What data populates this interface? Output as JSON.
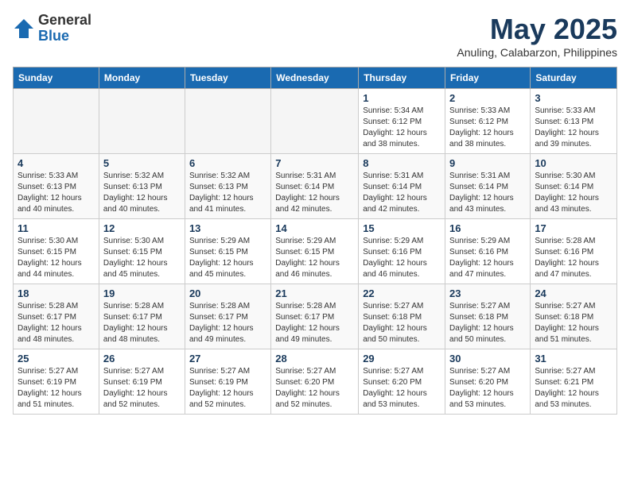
{
  "header": {
    "logo_general": "General",
    "logo_blue": "Blue",
    "month_title": "May 2025",
    "subtitle": "Anuling, Calabarzon, Philippines"
  },
  "weekdays": [
    "Sunday",
    "Monday",
    "Tuesday",
    "Wednesday",
    "Thursday",
    "Friday",
    "Saturday"
  ],
  "weeks": [
    [
      {
        "day": "",
        "info": ""
      },
      {
        "day": "",
        "info": ""
      },
      {
        "day": "",
        "info": ""
      },
      {
        "day": "",
        "info": ""
      },
      {
        "day": "1",
        "info": "Sunrise: 5:34 AM\nSunset: 6:12 PM\nDaylight: 12 hours\nand 38 minutes."
      },
      {
        "day": "2",
        "info": "Sunrise: 5:33 AM\nSunset: 6:12 PM\nDaylight: 12 hours\nand 38 minutes."
      },
      {
        "day": "3",
        "info": "Sunrise: 5:33 AM\nSunset: 6:13 PM\nDaylight: 12 hours\nand 39 minutes."
      }
    ],
    [
      {
        "day": "4",
        "info": "Sunrise: 5:33 AM\nSunset: 6:13 PM\nDaylight: 12 hours\nand 40 minutes."
      },
      {
        "day": "5",
        "info": "Sunrise: 5:32 AM\nSunset: 6:13 PM\nDaylight: 12 hours\nand 40 minutes."
      },
      {
        "day": "6",
        "info": "Sunrise: 5:32 AM\nSunset: 6:13 PM\nDaylight: 12 hours\nand 41 minutes."
      },
      {
        "day": "7",
        "info": "Sunrise: 5:31 AM\nSunset: 6:14 PM\nDaylight: 12 hours\nand 42 minutes."
      },
      {
        "day": "8",
        "info": "Sunrise: 5:31 AM\nSunset: 6:14 PM\nDaylight: 12 hours\nand 42 minutes."
      },
      {
        "day": "9",
        "info": "Sunrise: 5:31 AM\nSunset: 6:14 PM\nDaylight: 12 hours\nand 43 minutes."
      },
      {
        "day": "10",
        "info": "Sunrise: 5:30 AM\nSunset: 6:14 PM\nDaylight: 12 hours\nand 43 minutes."
      }
    ],
    [
      {
        "day": "11",
        "info": "Sunrise: 5:30 AM\nSunset: 6:15 PM\nDaylight: 12 hours\nand 44 minutes."
      },
      {
        "day": "12",
        "info": "Sunrise: 5:30 AM\nSunset: 6:15 PM\nDaylight: 12 hours\nand 45 minutes."
      },
      {
        "day": "13",
        "info": "Sunrise: 5:29 AM\nSunset: 6:15 PM\nDaylight: 12 hours\nand 45 minutes."
      },
      {
        "day": "14",
        "info": "Sunrise: 5:29 AM\nSunset: 6:15 PM\nDaylight: 12 hours\nand 46 minutes."
      },
      {
        "day": "15",
        "info": "Sunrise: 5:29 AM\nSunset: 6:16 PM\nDaylight: 12 hours\nand 46 minutes."
      },
      {
        "day": "16",
        "info": "Sunrise: 5:29 AM\nSunset: 6:16 PM\nDaylight: 12 hours\nand 47 minutes."
      },
      {
        "day": "17",
        "info": "Sunrise: 5:28 AM\nSunset: 6:16 PM\nDaylight: 12 hours\nand 47 minutes."
      }
    ],
    [
      {
        "day": "18",
        "info": "Sunrise: 5:28 AM\nSunset: 6:17 PM\nDaylight: 12 hours\nand 48 minutes."
      },
      {
        "day": "19",
        "info": "Sunrise: 5:28 AM\nSunset: 6:17 PM\nDaylight: 12 hours\nand 48 minutes."
      },
      {
        "day": "20",
        "info": "Sunrise: 5:28 AM\nSunset: 6:17 PM\nDaylight: 12 hours\nand 49 minutes."
      },
      {
        "day": "21",
        "info": "Sunrise: 5:28 AM\nSunset: 6:17 PM\nDaylight: 12 hours\nand 49 minutes."
      },
      {
        "day": "22",
        "info": "Sunrise: 5:27 AM\nSunset: 6:18 PM\nDaylight: 12 hours\nand 50 minutes."
      },
      {
        "day": "23",
        "info": "Sunrise: 5:27 AM\nSunset: 6:18 PM\nDaylight: 12 hours\nand 50 minutes."
      },
      {
        "day": "24",
        "info": "Sunrise: 5:27 AM\nSunset: 6:18 PM\nDaylight: 12 hours\nand 51 minutes."
      }
    ],
    [
      {
        "day": "25",
        "info": "Sunrise: 5:27 AM\nSunset: 6:19 PM\nDaylight: 12 hours\nand 51 minutes."
      },
      {
        "day": "26",
        "info": "Sunrise: 5:27 AM\nSunset: 6:19 PM\nDaylight: 12 hours\nand 52 minutes."
      },
      {
        "day": "27",
        "info": "Sunrise: 5:27 AM\nSunset: 6:19 PM\nDaylight: 12 hours\nand 52 minutes."
      },
      {
        "day": "28",
        "info": "Sunrise: 5:27 AM\nSunset: 6:20 PM\nDaylight: 12 hours\nand 52 minutes."
      },
      {
        "day": "29",
        "info": "Sunrise: 5:27 AM\nSunset: 6:20 PM\nDaylight: 12 hours\nand 53 minutes."
      },
      {
        "day": "30",
        "info": "Sunrise: 5:27 AM\nSunset: 6:20 PM\nDaylight: 12 hours\nand 53 minutes."
      },
      {
        "day": "31",
        "info": "Sunrise: 5:27 AM\nSunset: 6:21 PM\nDaylight: 12 hours\nand 53 minutes."
      }
    ]
  ]
}
